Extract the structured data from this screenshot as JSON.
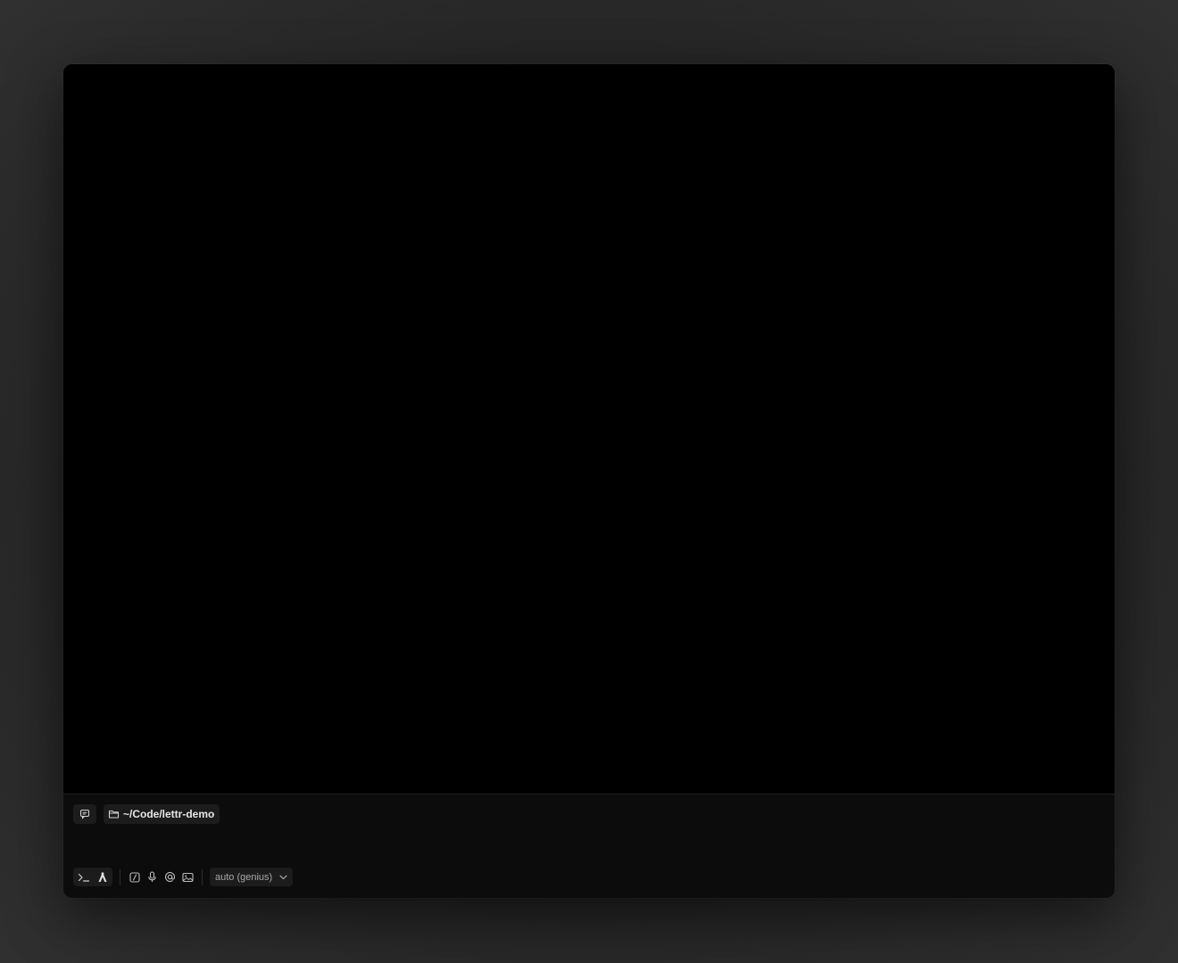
{
  "context": {
    "directory": "~/Code/lettr-demo"
  },
  "toolbar": {
    "model_label": "auto (genius)"
  },
  "icons": {
    "chat": "chat-bubble-icon",
    "folder": "folder-icon",
    "terminal": "terminal-prompt-icon",
    "agent": "agent-icon",
    "slash": "slash-command-icon",
    "mic": "microphone-icon",
    "mention": "at-mention-icon",
    "image": "image-attach-icon",
    "chevron": "chevron-down-icon"
  },
  "colors": {
    "window_bg": "#000000",
    "panel_bg": "#0c0c0c",
    "chip_bg": "#1c1c1c",
    "text_primary": "#e6e6e6",
    "text_muted": "#a8a8a8"
  }
}
